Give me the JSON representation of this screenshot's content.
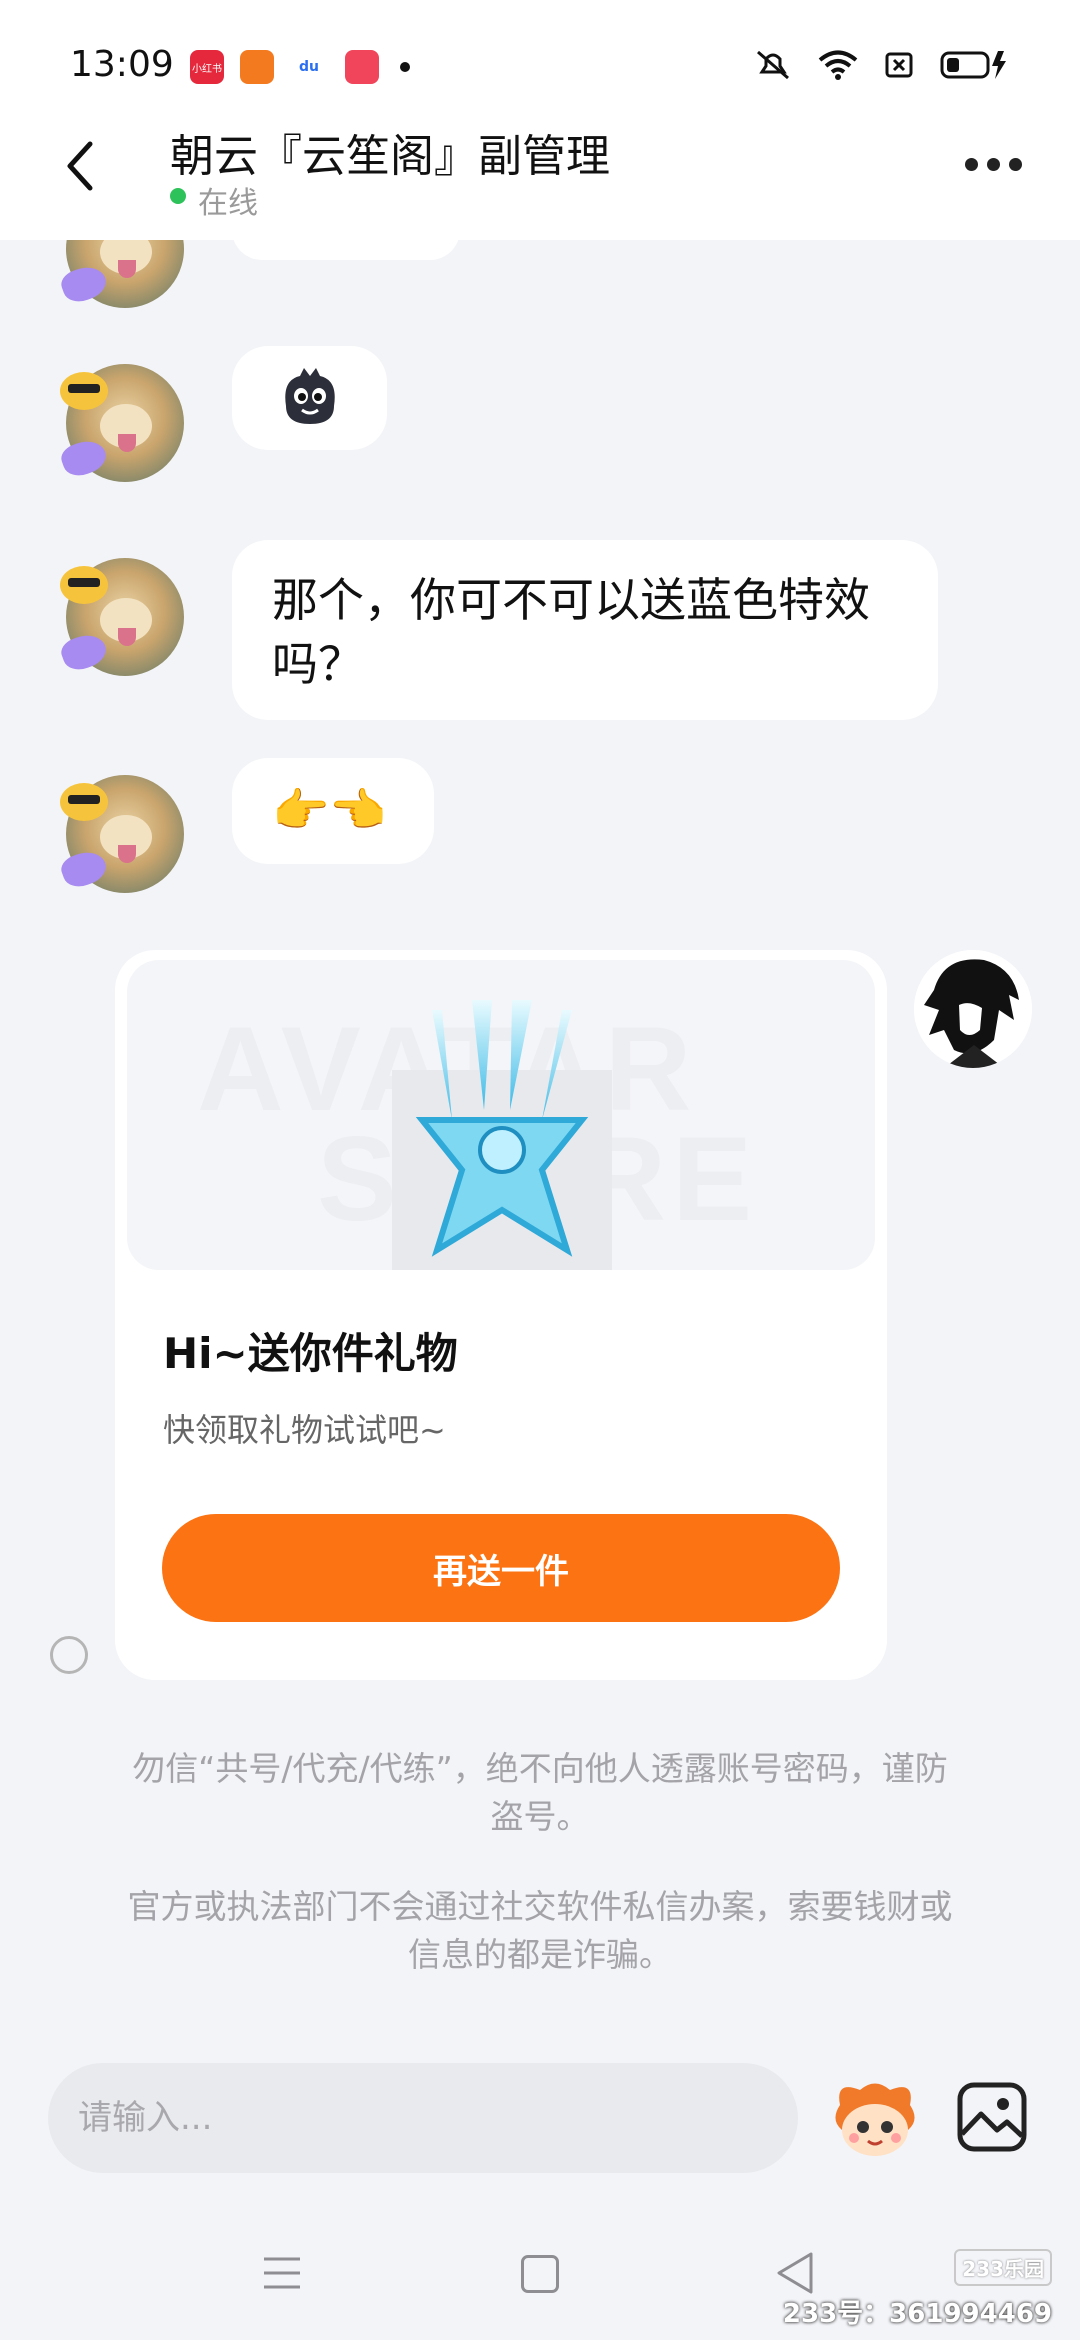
{
  "status_bar": {
    "time": "13:09",
    "app_icons": [
      "xiaohongshu-app-icon",
      "kuaishou-app-icon",
      "baidu-app-icon",
      "video-app-icon"
    ],
    "app_icon_labels": [
      "小红书",
      "",
      "du",
      ""
    ]
  },
  "header": {
    "title": "朝云『云笙阁』副管理",
    "status": "在线",
    "status_color": "#2ec25a"
  },
  "messages": [
    {
      "from": "other",
      "type": "sticker",
      "content": "dark-blob-sticker"
    },
    {
      "from": "other",
      "type": "text",
      "line1": "那个，你可不可以送蓝色特效",
      "line2": "吗？"
    },
    {
      "from": "other",
      "type": "emoji",
      "content": "👉👈"
    }
  ],
  "gift_card": {
    "watermark_line1": "AVATAR",
    "watermark_line2": "STORE",
    "title": "Hi~送你件礼物",
    "subtitle": "快领取礼物试试吧~",
    "button_label": "再送一件",
    "button_color": "#fb7312"
  },
  "notices": {
    "line1": "勿信“共号/代充/代练”，绝不向他人透露账号密码，谨防",
    "line1b": "盗号。",
    "line2": "官方或执法部门不会通过社交软件私信办案，索要钱财或",
    "line2b": "信息的都是诈骗。"
  },
  "input": {
    "placeholder": "请输入..."
  },
  "watermark": {
    "logo": "233乐园",
    "text": "233号：361994469"
  }
}
